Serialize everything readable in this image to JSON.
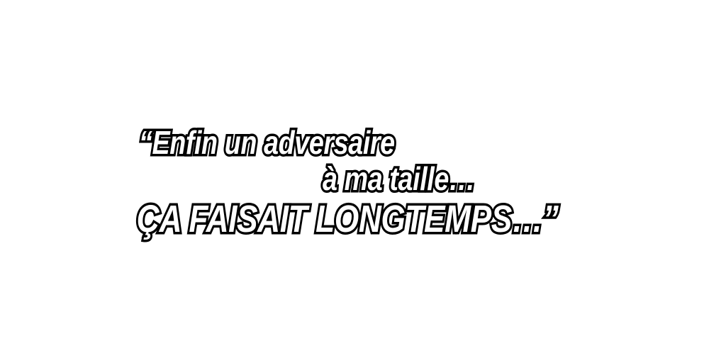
{
  "quote": {
    "line_1": "“Enfin un adversaire",
    "line_2": "à ma taille…",
    "line_3": "ÇA FAISAIT LONGTEMPS…”"
  },
  "colors": {
    "background": "#ffffff",
    "text_fill": "#ffffff",
    "text_outline": "#000000"
  }
}
